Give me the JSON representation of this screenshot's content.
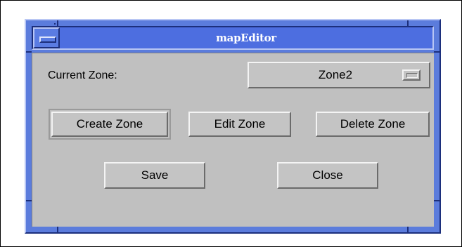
{
  "window": {
    "title": "mapEditor"
  },
  "zone_row": {
    "label": "Current Zone:",
    "selected_zone": "Zone2"
  },
  "buttons": {
    "create_zone": "Create Zone",
    "edit_zone": "Edit Zone",
    "delete_zone": "Delete Zone",
    "save": "Save",
    "close": "Close"
  },
  "icons": {
    "window_menu": "window-menu-icon",
    "option_indicator": "option-menu-indicator-icon"
  },
  "colors": {
    "title_bar": "#4d6ee0",
    "frame": "#5b7cdc",
    "client_bg": "#c0c0c0",
    "title_text": "#ffffff"
  }
}
